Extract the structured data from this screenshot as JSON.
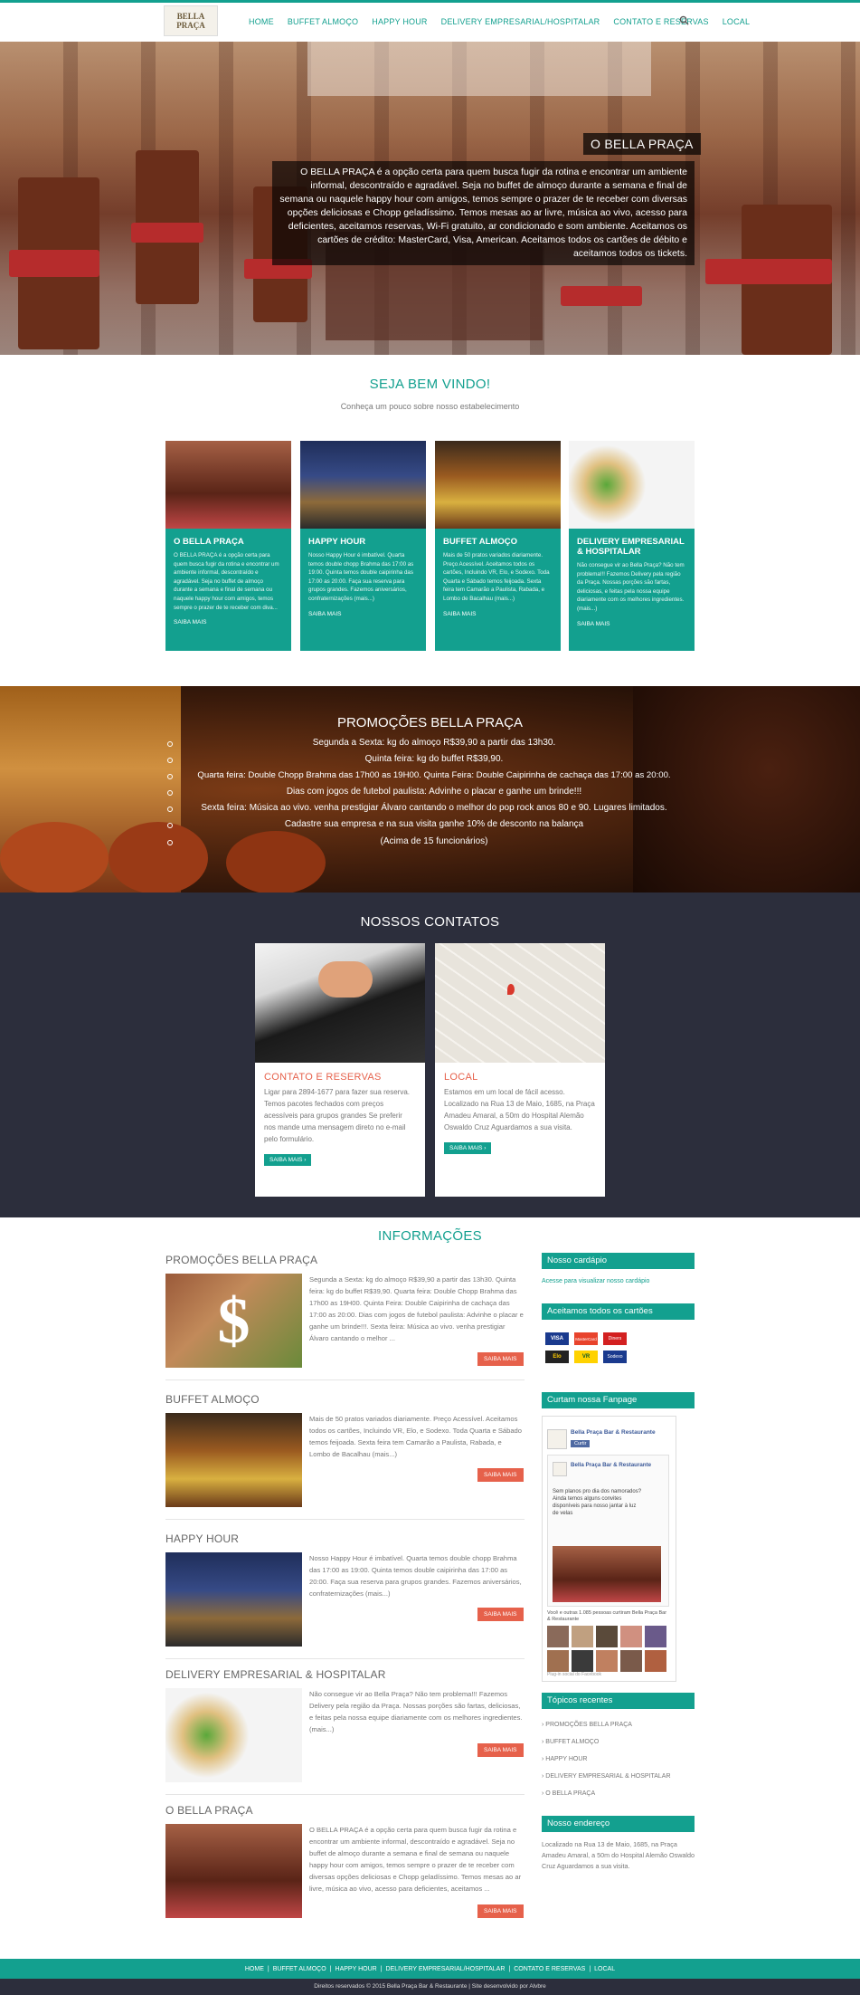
{
  "header": {
    "logo_text": "BELLA PRAÇA",
    "nav": [
      "HOME",
      "BUFFET ALMOÇO",
      "HAPPY HOUR",
      "DELIVERY EMPRESARIAL/HOSPITALAR",
      "CONTATO E RESERVAS",
      "LOCAL"
    ]
  },
  "hero": {
    "title": "O BELLA PRAÇA",
    "text": "O BELLA PRAÇA é a opção certa para quem busca fugir da rotina e encontrar um ambiente informal, descontraído e agradável. Seja no buffet de almoço durante a semana e final de semana ou naquele happy hour com amigos, temos sempre o prazer de te receber com diversas opções deliciosas e Chopp geladíssimo. Temos mesas ao ar livre, música ao vivo, acesso para deficientes, aceitamos reservas, Wi-Fi gratuito, ar condicionado e som ambiente. Aceitamos os cartões de crédito: MasterCard, Visa, American. Aceitamos todos os cartões de débito e aceitamos todos os tickets."
  },
  "welcome": {
    "title": "SEJA BEM VINDO!",
    "subtitle": "Conheça um pouco sobre nosso estabelecimento",
    "more_label": "SAIBA MAIS",
    "cards": [
      {
        "title": "O BELLA PRAÇA",
        "text": "O BELLA PRAÇA é a opção certa para quem busca fugir da rotina e encontrar um ambiente informal, descontraído e agradável. Seja no buffet de almoço durante a semana e final de semana ou naquele happy hour com amigos, temos sempre o prazer de te receber com diva..."
      },
      {
        "title": "HAPPY HOUR",
        "text": "Nosso Happy Hour é imbatível. Quarta temos double chopp Brahma das 17:00 as 19:00. Quinta temos double caipirinha das 17:00 as 20:00. Faça sua reserva para grupos grandes. Fazemos aniversários, confraternizações (mais...)"
      },
      {
        "title": "BUFFET ALMOÇO",
        "text": "Mais de 50 pratos variados diariamente. Preço Acessível. Aceitamos todos os cartões, Incluindo VR, Elo, e Sodexo. Toda Quarta e Sábado temos feijoada. Sexta feira tem Camarão a Paulista, Rabada, e Lombo de Bacalhau (mais...)"
      },
      {
        "title": "DELIVERY EMPRESARIAL & HOSPITALAR",
        "text": "Não consegue vir ao Bella Praça? Não tem problema!!! Fazemos Delivery pela região da Praça. Nossas porções são fartas, deliciosas, e feitas pela nossa equipe diariamente com os melhores ingredientes. (mais...)"
      }
    ]
  },
  "promo": {
    "title": "PROMOÇÕES BELLA PRAÇA",
    "items": [
      "Segunda a Sexta: kg do almoço R$39,90 a partir das 13h30.",
      "Quinta feira: kg do buffet R$39,90.",
      "Quarta feira: Double Chopp Brahma das 17h00 as 19H00. Quinta Feira: Double Caipirinha de cachaça das 17:00 as 20:00.",
      "Dias com jogos de futebol paulista: Advinhe o placar e ganhe um brinde!!!",
      "Sexta feira: Música ao vivo. venha prestigiar Álvaro cantando o melhor do pop rock anos 80 e 90. Lugares limitados.",
      "Cadastre sua empresa e na sua visita ganhe 10% de desconto na balança",
      "(Acima de 15 funcionários)"
    ]
  },
  "contacts": {
    "title": "NOSSOS CONTATOS",
    "more_label": "SAIBA MAIS",
    "cards": [
      {
        "title": "CONTATO E RESERVAS",
        "text": "Ligar para 2894-1677 para fazer sua reserva. Temos pacotes fechados com preços acessíveis para grupos grandes Se preferir nos mande uma mensagem direto no e-mail pelo formulário."
      },
      {
        "title": "LOCAL",
        "text": "Estamos em um local de fácil acesso. Localizado na Rua 13 de Maio, 1685, na Praça Amadeu Amaral, a 50m do Hospital Alemão Oswaldo Cruz Aguardamos a sua visita."
      }
    ]
  },
  "info": {
    "title": "INFORMAÇÕES",
    "more_label": "SAIBA MAIS",
    "posts": [
      {
        "title": "PROMOÇÕES BELLA PRAÇA",
        "text": "Segunda a Sexta: kg do almoço R$39,90 a partir das 13h30. Quinta feira: kg do buffet R$39,90. Quarta feira: Double Chopp Brahma das 17h00 as 19H00. Quinta Feira: Double Caipirinha de cachaça das 17:00 as 20:00. Dias com jogos de futebol paulista: Advinhe o placar e ganhe um brinde!!!. Sexta feira: Música ao vivo. venha prestigiar Álvaro cantando o melhor ..."
      },
      {
        "title": "BUFFET ALMOÇO",
        "text": "Mais de 50 pratos variados diariamente. Preço Acessível. Aceitamos todos os cartões, Incluindo VR, Elo, e Sodexo. Toda Quarta e Sábado temos feijoada. Sexta feira tem Camarão a Paulista, Rabada, e Lombo de Bacalhau (mais...)"
      },
      {
        "title": "HAPPY HOUR",
        "text": "Nosso Happy Hour é imbatível. Quarta temos double chopp Brahma das 17:00 as 19:00. Quinta temos double caipirinha das 17:00 as 20:00. Faça sua reserva para grupos grandes. Fazemos aniversários, confraternizações (mais...)"
      },
      {
        "title": "DELIVERY EMPRESARIAL & HOSPITALAR",
        "text": "Não consegue vir ao Bella Praça? Não tem problema!!! Fazemos Delivery pela região da Praça. Nossas porções são fartas, deliciosas, e feitas pela nossa equipe diariamente com os melhores ingredientes. (mais...)"
      },
      {
        "title": "O BELLA PRAÇA",
        "text": "O BELLA PRAÇA é a opção certa para quem busca fugir da rotina e encontrar um ambiente informal, descontraído e agradável. Seja no buffet de almoço durante a semana e final de semana ou naquele happy hour com amigos, temos sempre o prazer de te receber com diversas opções deliciosas e Chopp geladíssimo. Temos mesas ao ar livre, música ao vivo, acesso para deficientes, aceitamos ..."
      }
    ]
  },
  "sidebar": {
    "cardapio_title": "Nosso cardápio",
    "cardapio_link": "Acesse para visualizar nosso cardápio",
    "cards_title": "Aceitamos todos os cartões",
    "card_brands": [
      "VISA",
      "MasterCard",
      "Diners",
      "Elo",
      "VR",
      "Sodexo"
    ],
    "fanpage_title": "Curtam nossa Fanpage",
    "fb_page_name": "Bella Praça Bar & Restaurante",
    "fb_like": "Curtir",
    "fb_post_name": "Bella Praça Bar & Restaurante",
    "fb_post_text": "Sem planos pro dia dos namorados? Ainda temos alguns convites disponíveis para nosso jantar à luz de velas",
    "fb_likes_text": "Você e outras 1.085 pessoas curtiram Bella Praça Bar & Restaurante",
    "fb_plugin": "Plug-in social do Facebook",
    "recent_title": "Tópicos recentes",
    "recent": [
      "PROMOÇÕES BELLA PRAÇA",
      "BUFFET ALMOÇO",
      "HAPPY HOUR",
      "DELIVERY EMPRESARIAL & HOSPITALAR",
      "O BELLA PRAÇA"
    ],
    "address_title": "Nosso endereço",
    "address": "Localizado na Rua 13 de Maio, 1685, na Praça Amadeu Amaral, a 50m do Hospital Alemão Oswaldo Cruz Aguardamos a sua visita."
  },
  "footer": {
    "nav": [
      "HOME",
      "BUFFET ALMOÇO",
      "HAPPY HOUR",
      "DELIVERY EMPRESARIAL/HOSPITALAR",
      "CONTATO E RESERVAS",
      "LOCAL"
    ],
    "copyright": "Direitos reservados © 2015 Bella Praça Bar & Restaurante | Site desenvolvido por Alvbre"
  },
  "colors": {
    "accent": "#13a08f",
    "button_orange": "#e6614b",
    "dark": "#2c2e3c"
  }
}
